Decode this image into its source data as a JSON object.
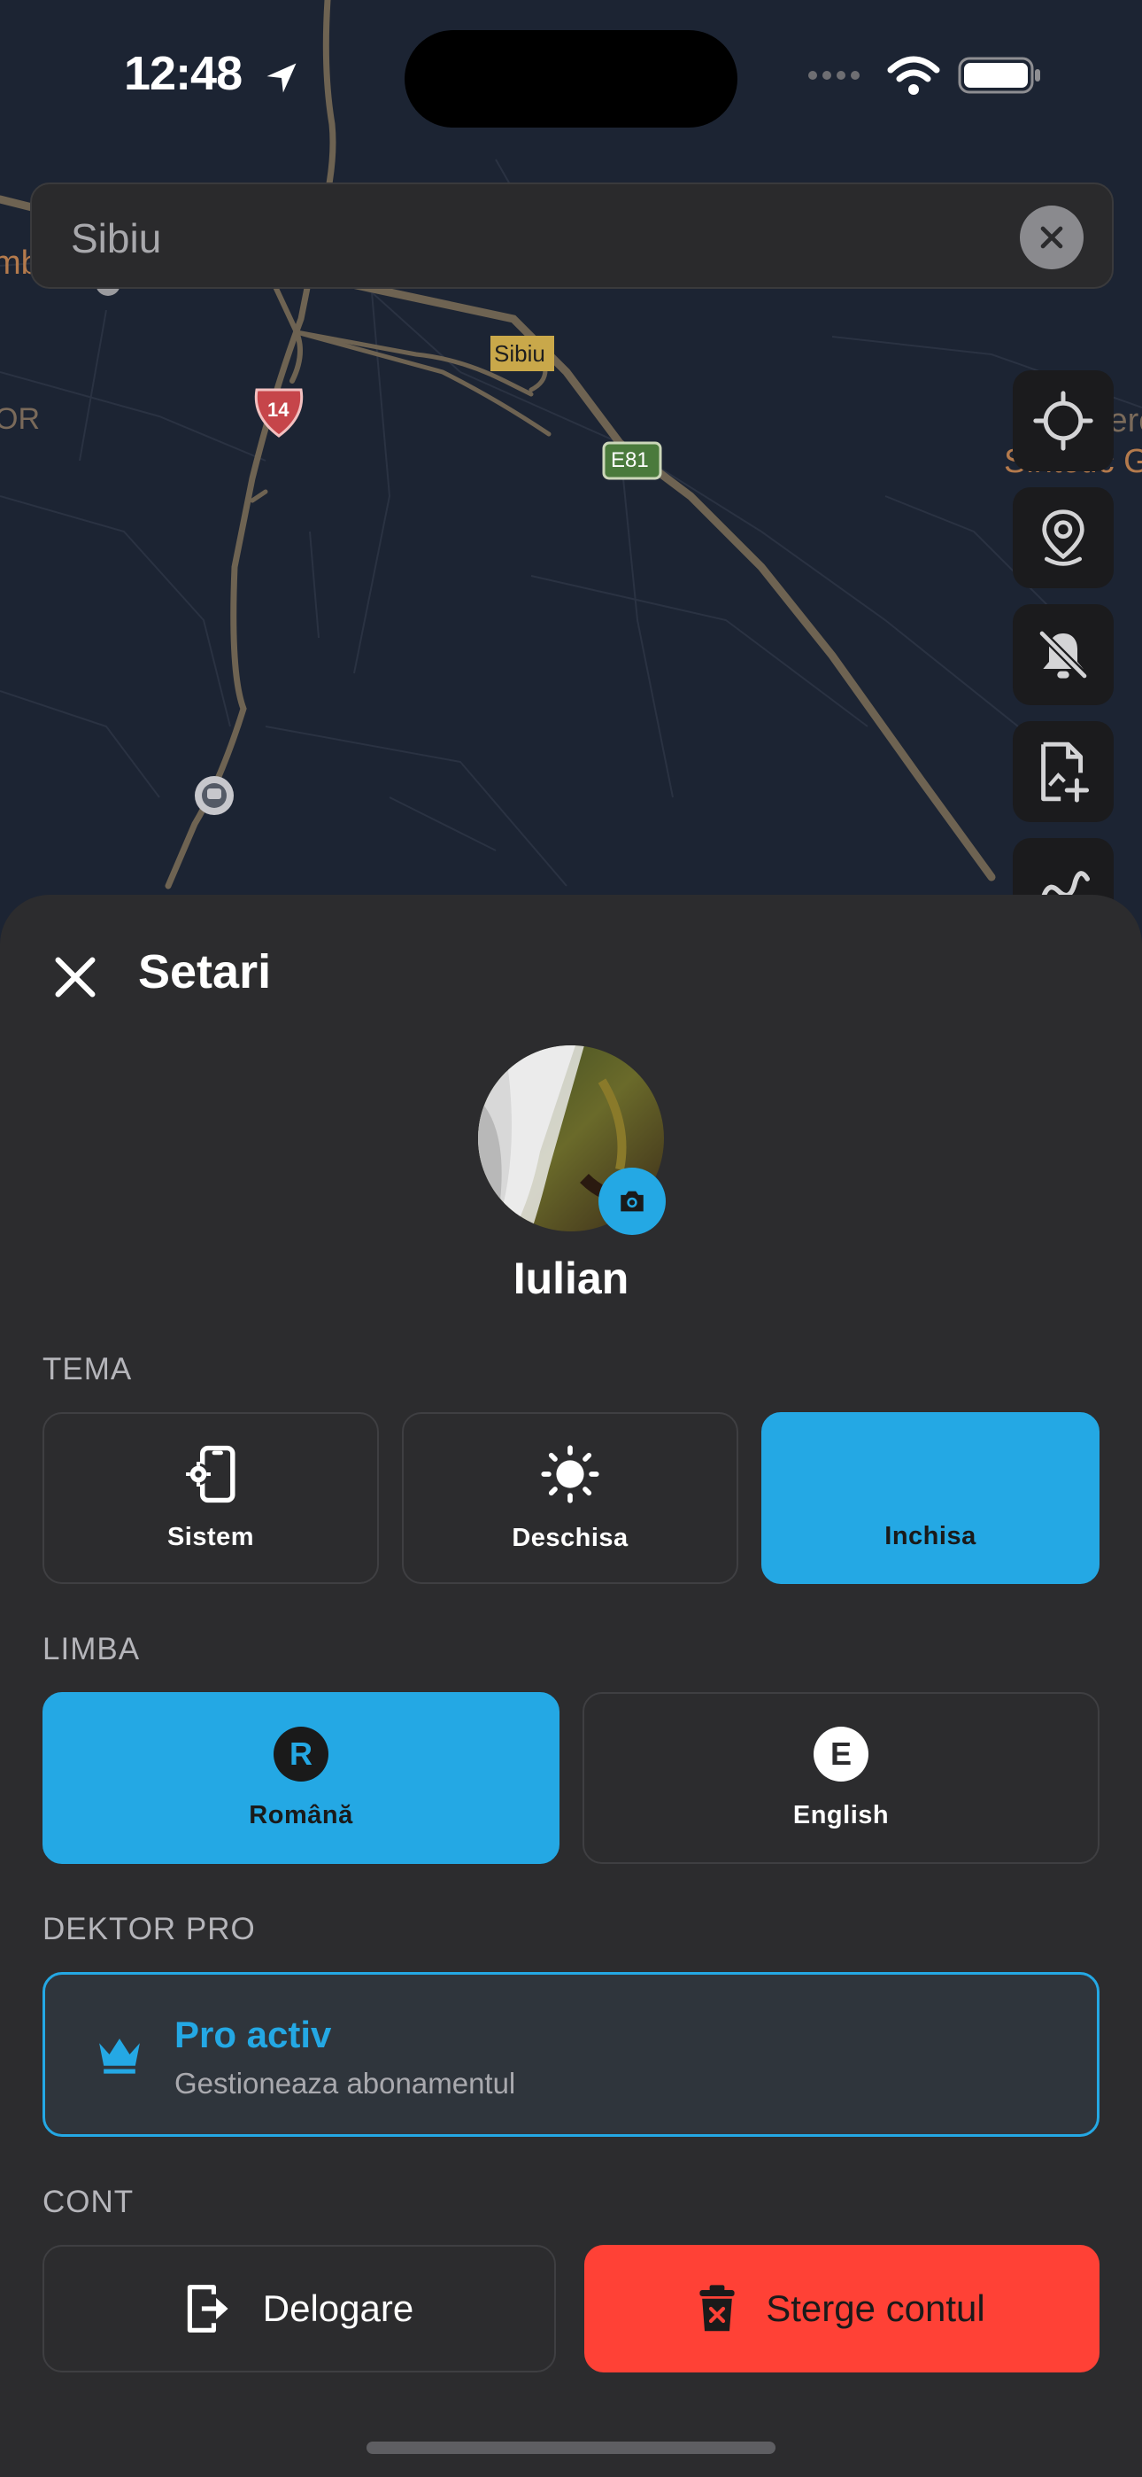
{
  "status_bar": {
    "time": "12:48"
  },
  "map": {
    "search_value": "Sibiu",
    "labels": {
      "city": "Sibiu",
      "road_14": "14",
      "road_e81": "E81",
      "left_edge": "mbi",
      "left_or": "OR",
      "right_edge_1": "iere",
      "right_edge_2": "Sintetic G"
    }
  },
  "settings": {
    "title": "Setari",
    "user_name": "Iulian",
    "theme": {
      "label": "TEMA",
      "options": [
        {
          "label": "Sistem",
          "icon": "phone-gear-icon"
        },
        {
          "label": "Deschisa",
          "icon": "sun-icon"
        },
        {
          "label": "Inchisa",
          "icon": "moon-icon",
          "selected": true
        }
      ]
    },
    "language": {
      "label": "LIMBA",
      "options": [
        {
          "label": "Română",
          "badge": "R",
          "selected": true
        },
        {
          "label": "English",
          "badge": "E"
        }
      ]
    },
    "pro": {
      "label": "DEKTOR PRO",
      "title": "Pro activ",
      "subtitle": "Gestioneaza abonamentul",
      "icon": "crown-icon"
    },
    "account": {
      "label": "CONT",
      "logout": "Delogare",
      "delete": "Sterge contul"
    }
  },
  "colors": {
    "accent": "#24a8e4",
    "danger": "#ff4136",
    "sheet_bg": "#2c2c2e"
  }
}
